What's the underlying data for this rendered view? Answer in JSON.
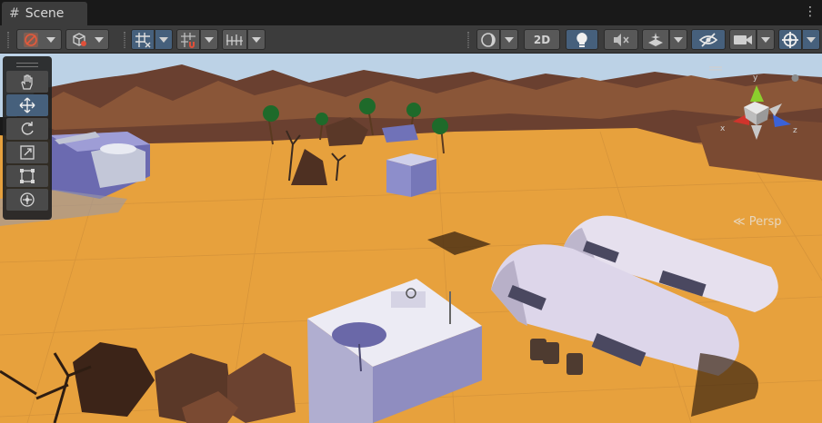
{
  "window": {
    "tab_title": "Scene"
  },
  "toolbar": {
    "mode_2d_label": "2D",
    "buttons": {
      "gizmo_tool": "move-tool",
      "draw_mode": "shaded",
      "grid_snap": "grid",
      "increment_snap": "snap",
      "ruler": "ruler",
      "render_mode": "sphere",
      "lighting": "lighting-on",
      "audio": "audio-muted",
      "effects": "effects",
      "visibility": "hidden-objects",
      "camera": "camera",
      "gizmos": "gizmos"
    }
  },
  "tools_panel": {
    "tools": [
      "hand",
      "move",
      "rotate",
      "scale",
      "rect",
      "transform"
    ],
    "active_tool": "move"
  },
  "scene_gizmo": {
    "axes": {
      "x": "x",
      "y": "y",
      "z": "z"
    },
    "projection_label": "Persp"
  },
  "colors": {
    "sand": "#e7a13d",
    "sky": "#bcd2e6",
    "cliff": "#6a4030",
    "accent_active": "#46607c",
    "x_axis": "#d0342c",
    "y_axis": "#8bcf2d",
    "z_axis": "#3a62d8"
  }
}
